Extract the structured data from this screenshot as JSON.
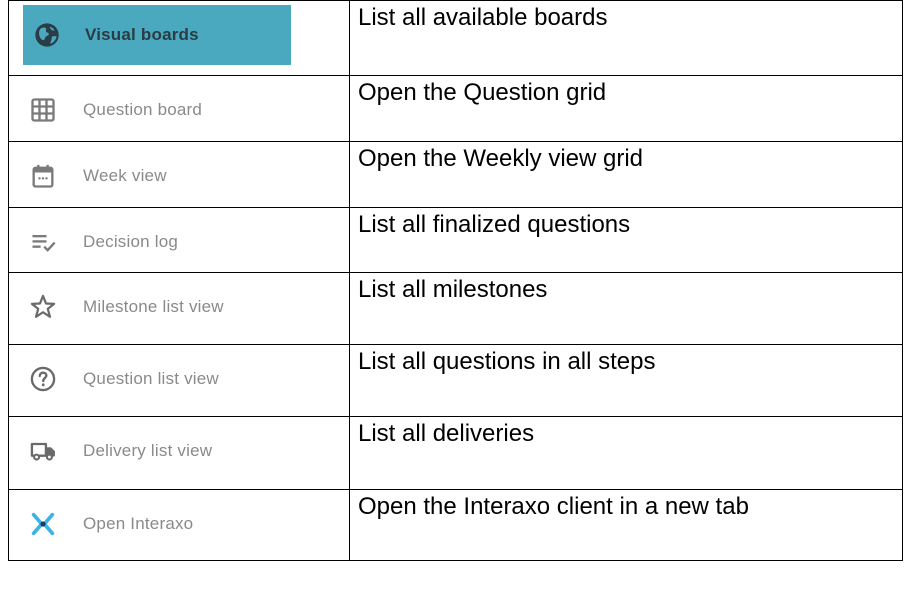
{
  "colors": {
    "active_background": "#4aa8bf",
    "active_text": "#2a3c45",
    "inactive_text": "#8a8a8a",
    "icon_gray": "#7a7a7a",
    "interaxo_blue_light": "#3bb4e5",
    "interaxo_blue_dark": "#1e3a5f",
    "border": "#000000"
  },
  "rows": [
    {
      "label": "Visual boards",
      "description": "List all available boards",
      "icon": "globe-icon",
      "active": true
    },
    {
      "label": "Question board",
      "description": "Open the Question grid",
      "icon": "grid-icon",
      "active": false
    },
    {
      "label": "Week view",
      "description": "Open the Weekly view grid",
      "icon": "calendar-icon",
      "active": false
    },
    {
      "label": "Decision log",
      "description": "List all finalized questions",
      "icon": "list-check-icon",
      "active": false
    },
    {
      "label": "Milestone list view",
      "description": "List all milestones",
      "icon": "star-icon",
      "active": false
    },
    {
      "label": "Question list view",
      "description": "List all questions in all steps",
      "icon": "question-circle-icon",
      "active": false
    },
    {
      "label": "Delivery list view",
      "description": "List all deliveries",
      "icon": "truck-icon",
      "active": false
    },
    {
      "label": "Open Interaxo",
      "description": "Open the Interaxo client in a new tab",
      "icon": "interaxo-logo-icon",
      "active": false
    }
  ]
}
